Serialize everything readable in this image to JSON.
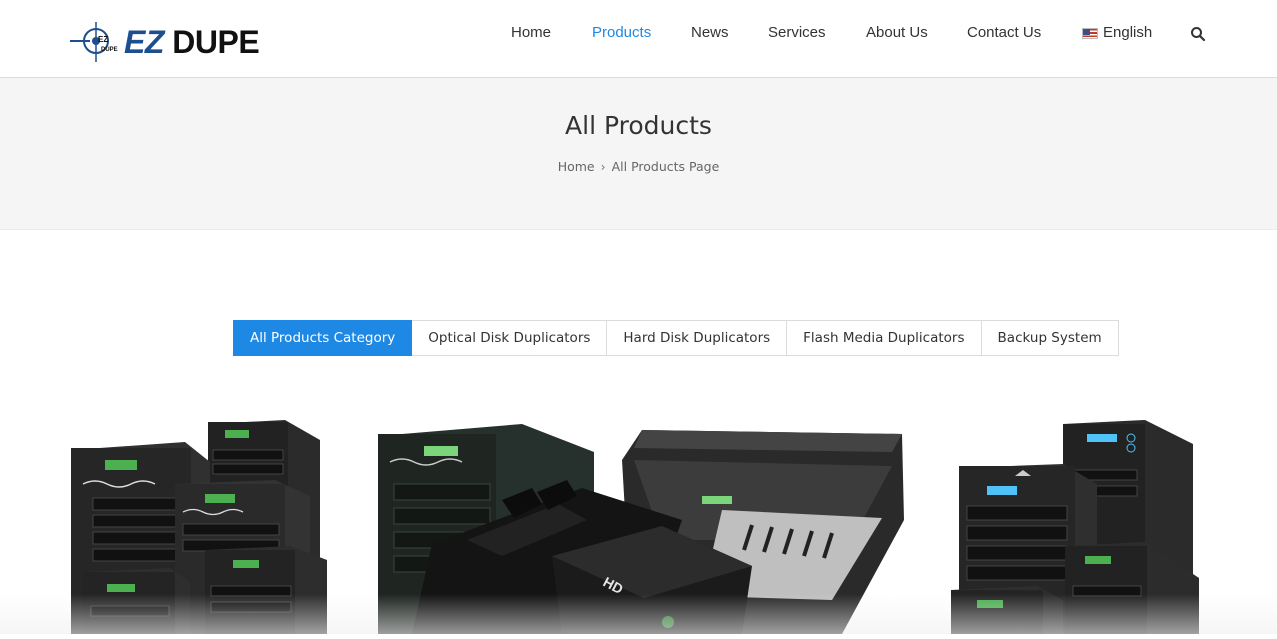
{
  "brand": {
    "logo_mark": "EZ DUPE",
    "name_ez": "EZ",
    "name_dupe": " DUPE",
    "accent_color": "#1d4f8f"
  },
  "nav": {
    "items": [
      {
        "label": "Home",
        "active": false
      },
      {
        "label": "Products",
        "active": true
      },
      {
        "label": "News",
        "active": false
      },
      {
        "label": "Services",
        "active": false
      },
      {
        "label": "About Us",
        "active": false
      },
      {
        "label": "Contact Us",
        "active": false
      }
    ],
    "language": {
      "label": "English",
      "flag_icon": "us-flag-icon"
    },
    "search_icon": "search-icon",
    "active_color": "#1e88e5"
  },
  "page": {
    "title": "All Products",
    "breadcrumb": {
      "home": "Home",
      "separator": "›",
      "current": "All Products Page"
    }
  },
  "tabs": [
    {
      "label": "All Products Category",
      "active": true
    },
    {
      "label": "Optical Disk Duplicators",
      "active": false
    },
    {
      "label": "Hard Disk Duplicators",
      "active": false
    },
    {
      "label": "Flash Media Duplicators",
      "active": false
    },
    {
      "label": "Backup System",
      "active": false
    }
  ],
  "products": [
    {
      "icon": "optical-disc-duplicator-towers-image"
    },
    {
      "icon": "hard-drive-duplicator-image"
    },
    {
      "icon": "usb-flash-duplicator-towers-image"
    }
  ]
}
